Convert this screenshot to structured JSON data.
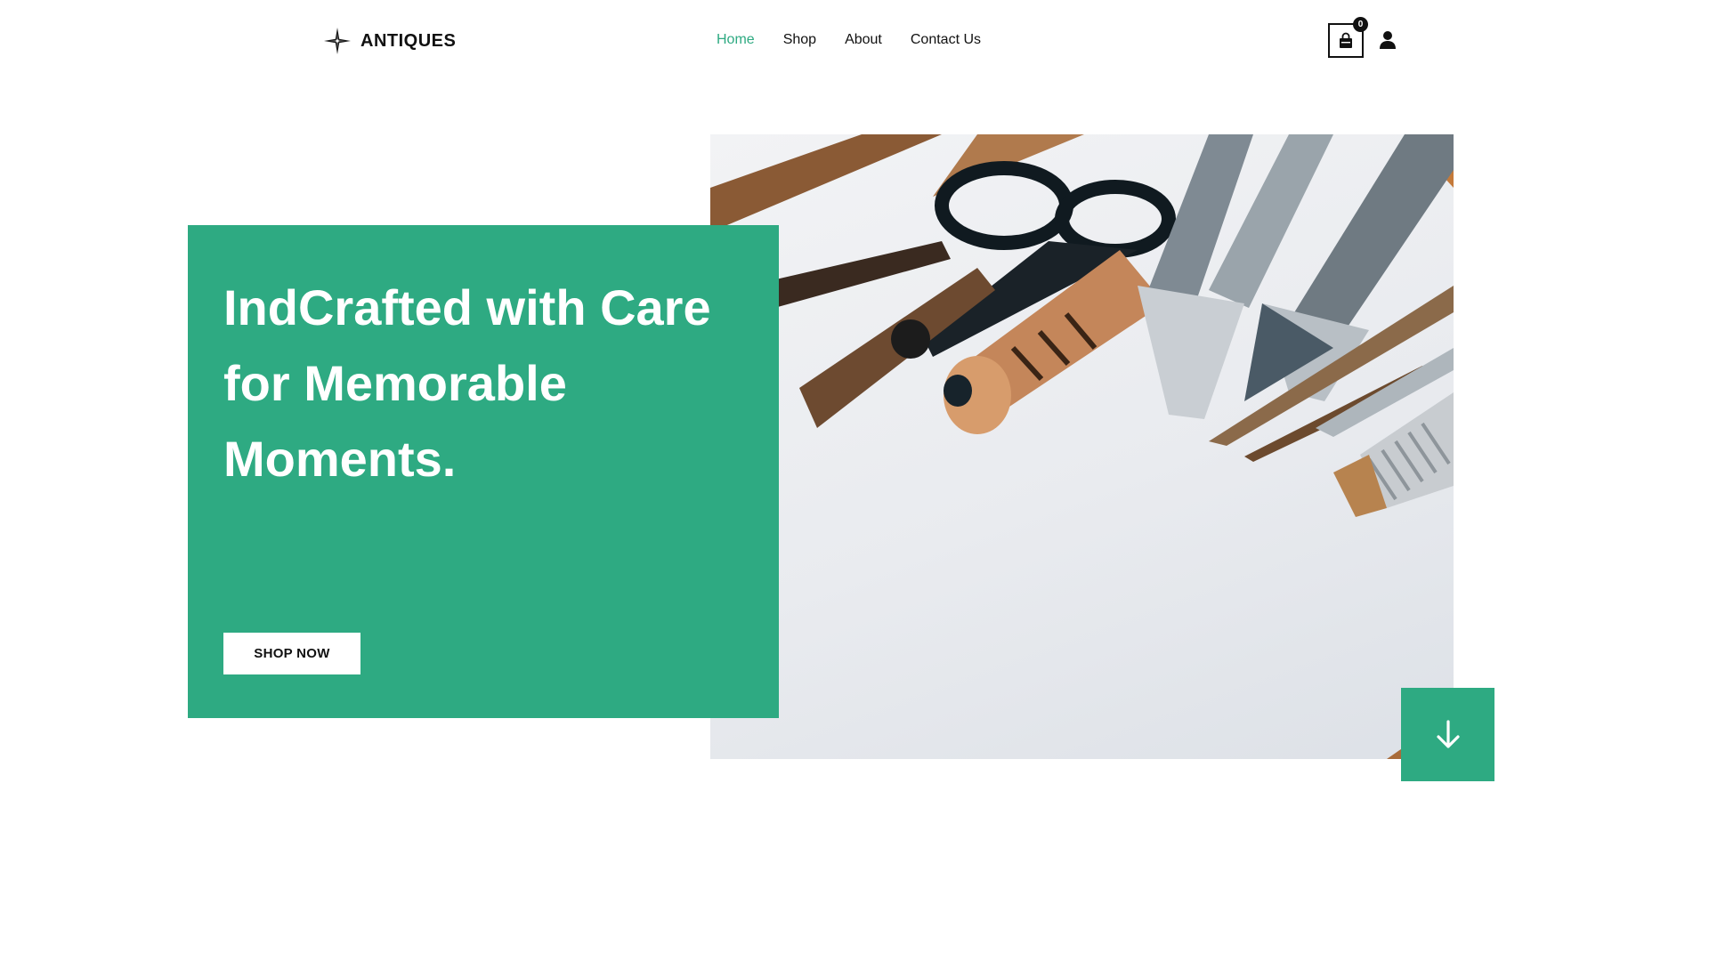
{
  "brand": {
    "name": "ANTIQUES",
    "logo_icon": "compass-star-icon"
  },
  "nav": {
    "items": [
      {
        "label": "Home",
        "active": true
      },
      {
        "label": "Shop",
        "active": false
      },
      {
        "label": "About",
        "active": false
      },
      {
        "label": "Contact Us",
        "active": false
      }
    ]
  },
  "header_actions": {
    "cart_icon": "shopping-bag-icon",
    "cart_count": "0",
    "user_icon": "user-icon"
  },
  "hero": {
    "title": "IndCrafted with Care for Memorable Moments.",
    "cta_label": "SHOP NOW",
    "image_subject": "craft-tools-photo",
    "scroll_icon": "arrow-down-icon"
  },
  "colors": {
    "accent": "#2eaa82",
    "text": "#111111",
    "background": "#ffffff"
  }
}
